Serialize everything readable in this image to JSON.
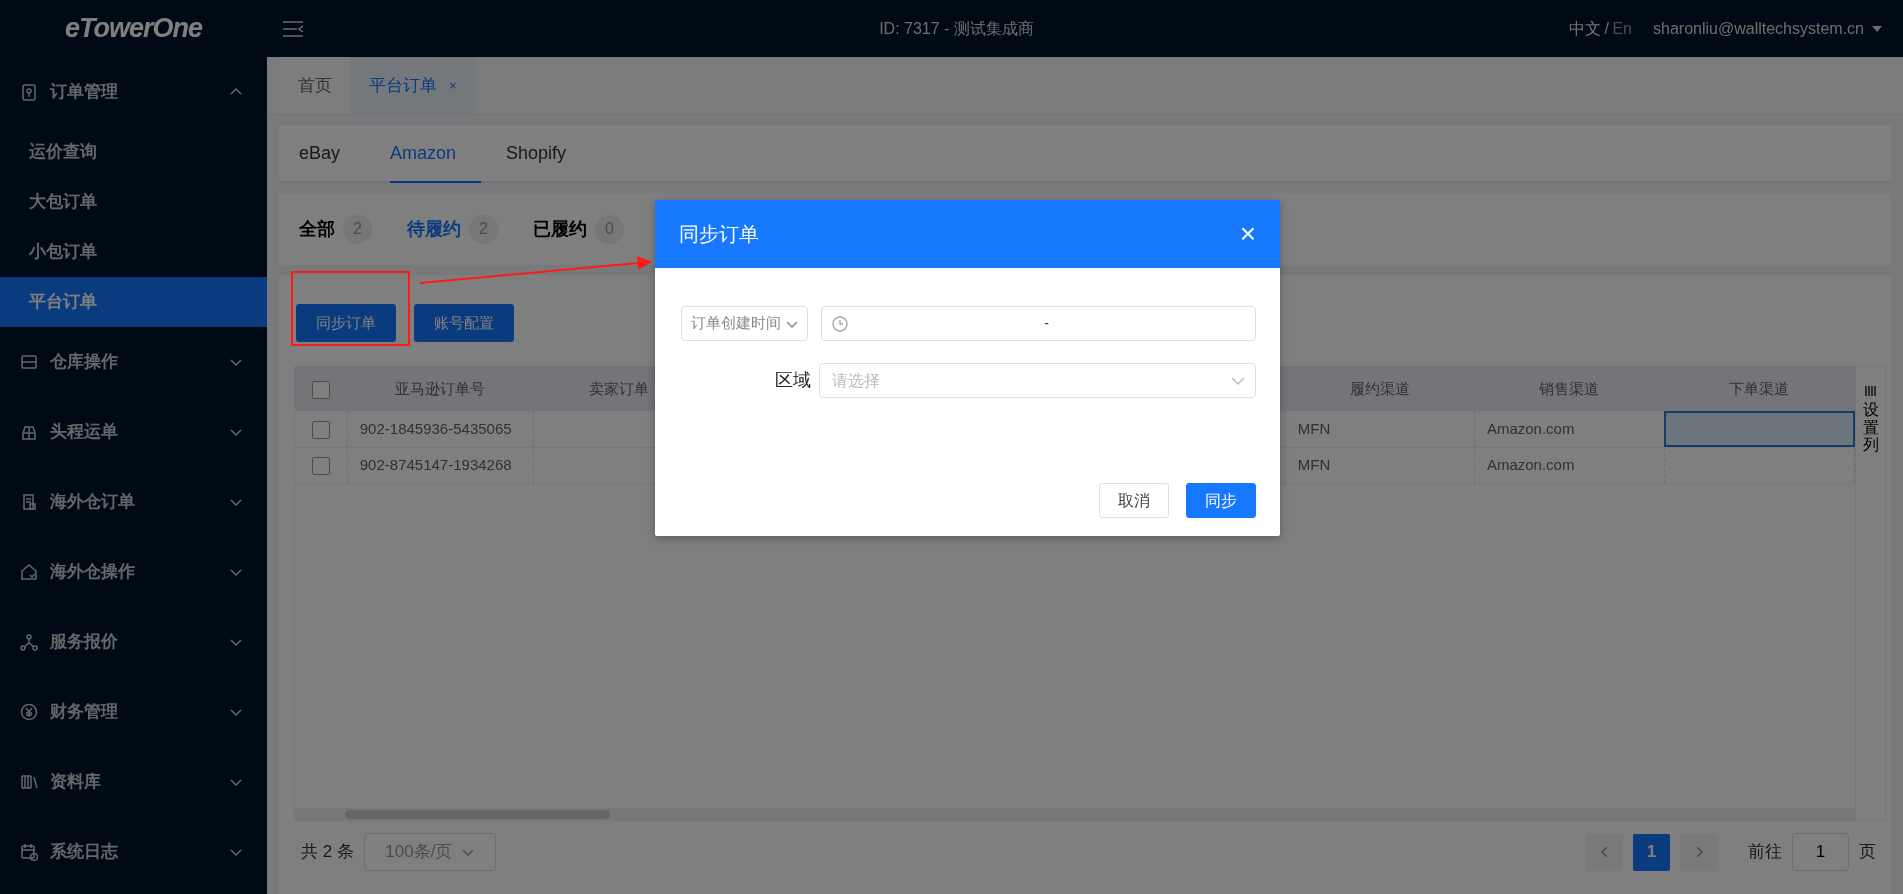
{
  "brand": {
    "logo": "eTowerOne"
  },
  "header": {
    "title": "ID: 7317 - 测试集成商",
    "languages": [
      {
        "label": "中文",
        "selected": true
      },
      {
        "label": "En",
        "selected": false
      }
    ],
    "language_separator": "/",
    "user": "sharonliu@walltechsystem.cn"
  },
  "sidebar": {
    "items": [
      {
        "label": "订单管理",
        "expanded": true,
        "children": [
          {
            "label": "运价查询",
            "selected": false
          },
          {
            "label": "大包订单",
            "selected": false
          },
          {
            "label": "小包订单",
            "selected": false
          },
          {
            "label": "平台订单",
            "selected": true
          }
        ]
      },
      {
        "label": "仓库操作",
        "expanded": false
      },
      {
        "label": "头程运单",
        "expanded": false
      },
      {
        "label": "海外仓订单",
        "expanded": false
      },
      {
        "label": "海外仓操作",
        "expanded": false
      },
      {
        "label": "服务报价",
        "expanded": false
      },
      {
        "label": "财务管理",
        "expanded": false
      },
      {
        "label": "资料库",
        "expanded": false
      },
      {
        "label": "系统日志",
        "expanded": false
      }
    ]
  },
  "page_tabs": [
    {
      "label": "首页",
      "selected": false,
      "closable": false
    },
    {
      "label": "平台订单",
      "selected": true,
      "closable": true,
      "close": "×"
    }
  ],
  "platform_tabs": [
    {
      "label": "eBay",
      "selected": false
    },
    {
      "label": "Amazon",
      "selected": true
    },
    {
      "label": "Shopify",
      "selected": false
    }
  ],
  "status_tabs": [
    {
      "label": "全部",
      "count": "2",
      "selected": false
    },
    {
      "label": "待履约",
      "count": "2",
      "selected": true
    },
    {
      "label": "已履约",
      "count": "0",
      "selected": false
    }
  ],
  "toolbar": {
    "buttons": [
      "同步订单",
      "账号配置"
    ]
  },
  "table": {
    "columns": [
      "亚马逊订单号",
      "卖家订单",
      "履约渠道",
      "销售渠道",
      "下单渠道"
    ],
    "column_settings": "设置列",
    "header_checked": false,
    "rows": [
      {
        "checked": false,
        "amazon_order_no": "902-1845936-5435065",
        "fulfillment_channel": "MFN",
        "sales_channel": "Amazon.com",
        "focused": true
      },
      {
        "checked": false,
        "amazon_order_no": "902-8745147-1934268",
        "fulfillment_channel": "MFN",
        "sales_channel": "Amazon.com",
        "focused": false
      }
    ]
  },
  "pagination": {
    "total": "共 2 条",
    "page_size": "100条/页",
    "pages": [
      {
        "label": "1",
        "selected": true
      }
    ],
    "goto_label": "前往",
    "goto_value": "1",
    "goto_suffix": "页"
  },
  "dialog": {
    "title": "同步订单",
    "close": "×",
    "date_type": "订单创建时间",
    "date_separator": "-",
    "region_label": "区域",
    "region_placeholder": "请选择",
    "buttons": [
      {
        "label": "取消",
        "kind": "secondary"
      },
      {
        "label": "同步",
        "kind": "primary"
      }
    ]
  },
  "annotation": {
    "highlight_box": true,
    "arrow": true
  }
}
